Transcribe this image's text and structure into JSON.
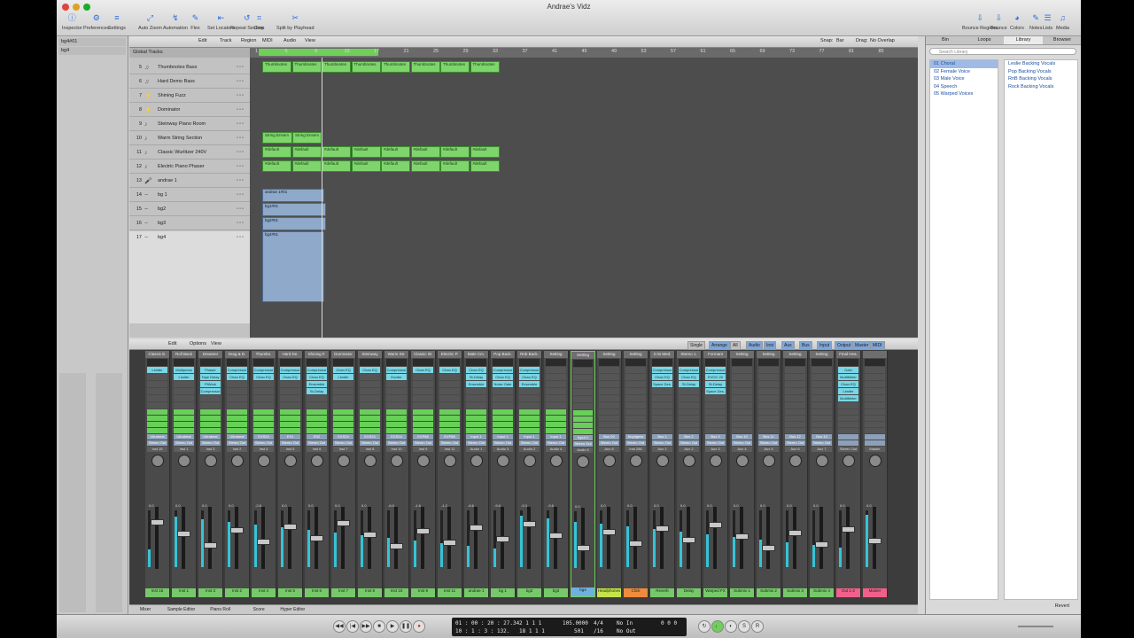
{
  "window": {
    "title": "Andrae's Vidz"
  },
  "toolbar": {
    "left": [
      "Inspector",
      "Preferences",
      "Settings"
    ],
    "center": [
      "Auto Zoom",
      "Automation",
      "Flex",
      "Set Locators",
      "Repeat Section",
      "Crop",
      "Split by Playhead"
    ],
    "right": [
      "Bounce Regions",
      "Bounce",
      "Colors",
      "Notes",
      "Lists",
      "Media"
    ]
  },
  "inspector": {
    "items": [
      "bg4#01",
      "bg4"
    ]
  },
  "tracks_bar": {
    "menus": [
      "Edit",
      "Track",
      "Region",
      "MIDI",
      "Audio",
      "View"
    ],
    "snap_label": "Snap:",
    "snap_value": "Bar",
    "drag_label": "Drag:",
    "drag_value": "No Overlap"
  },
  "global_tracks": "Global Tracks",
  "ruler": [
    "1",
    "5",
    "9",
    "13",
    "17",
    "21",
    "25",
    "29",
    "33",
    "37",
    "41",
    "45",
    "49",
    "53",
    "57",
    "61",
    "65",
    "69",
    "73",
    "77",
    "81",
    "85"
  ],
  "tracks": [
    {
      "num": "5",
      "name": "Thumbnotes Bass"
    },
    {
      "num": "6",
      "name": "Hard Demo Bass"
    },
    {
      "num": "7",
      "name": "Shining Fuzz"
    },
    {
      "num": "8",
      "name": "Dominator"
    },
    {
      "num": "9",
      "name": "Steinway Piano Room"
    },
    {
      "num": "10",
      "name": "Warm String Section"
    },
    {
      "num": "11",
      "name": "Classic Wurlitzer 240V"
    },
    {
      "num": "12",
      "name": "Electric Piano Phaser"
    },
    {
      "num": "13",
      "name": "andrae 1"
    },
    {
      "num": "14",
      "name": "bg 1"
    },
    {
      "num": "15",
      "name": "bg2"
    },
    {
      "num": "16",
      "name": "bg3"
    },
    {
      "num": "17",
      "name": "bg4"
    }
  ],
  "regions": {
    "thumb": "Thumbnotes",
    "string": "String Ensem",
    "default": "#default",
    "a1": "andrae 1#01",
    "a2": "bg1#01",
    "a3": "bg2#01",
    "a4": "bg4#01"
  },
  "library": {
    "tabs": [
      "Bin",
      "Loops",
      "Library",
      "Browser"
    ],
    "search_placeholder": "Search Library",
    "col1": [
      "01 Choral",
      "02 Female Voice",
      "03 Male Voice",
      "04 Speech",
      "05 Warped Voices"
    ],
    "col2": [
      "Leslie Backing Vocals",
      "Pop Backing Vocals",
      "RnB Backing Vocals",
      "Rock Backing Vocals"
    ],
    "revert": "Revert"
  },
  "mixer_bar": {
    "menus": [
      "Edit",
      "Options",
      "View"
    ],
    "modes": [
      "Single",
      "Arrange",
      "All"
    ],
    "filters": [
      "Audio",
      "Inst",
      "Aux",
      "Bus",
      "Input",
      "Output",
      "Master",
      "MIDI"
    ]
  },
  "channels": [
    {
      "hd": "Classic E.",
      "ins": [
        "Limiter"
      ],
      "io": "Ultrabeat",
      "out": "Stereo Out",
      "auto": "Inst 15",
      "db": "0.0",
      "name": "Inst 15"
    },
    {
      "hd": "Roll Back",
      "ins": [
        "Multipress",
        "Limiter"
      ],
      "io": "Ultrabeat",
      "out": "Stereo Out",
      "auto": "Inst 1",
      "db": "0.0",
      "name": "Inst 1"
    },
    {
      "hd": "Dreamer",
      "ins": [
        "Phaser",
        "Tape Delay",
        "PtWork",
        "Compressor"
      ],
      "io": "Ultrabeat",
      "out": "Stereo Out",
      "auto": "Inst 3",
      "db": "0.0",
      "name": "Inst 3"
    },
    {
      "hd": "Drag & D.",
      "ins": [
        "Compressor",
        "Chan EQ"
      ],
      "io": "Ultrabeat",
      "out": "Stereo Out",
      "auto": "Inst 2",
      "db": "0.0",
      "name": "Inst 2"
    },
    {
      "hd": "Thumbn.",
      "ins": [
        "Compressor",
        "Chan EQ"
      ],
      "io": "EXS24",
      "out": "Stereo Out",
      "auto": "Inst 4",
      "db": "-2.8",
      "name": "Inst 4"
    },
    {
      "hd": "Hard De.",
      "ins": [
        "Compressor",
        "Chan EQ"
      ],
      "io": "ES1",
      "out": "Stereo Out",
      "auto": "Inst 5",
      "db": "0.0",
      "name": "Inst 5"
    },
    {
      "hd": "Shining F.",
      "ins": [
        "Compressor",
        "Chan EQ",
        "Ensemble",
        "St-Delay"
      ],
      "io": "ES2",
      "out": "Stereo Out",
      "auto": "Inst 6",
      "db": "0.0",
      "name": "Inst 6"
    },
    {
      "hd": "Dominator",
      "ins": [
        "Chan EQ",
        "Limiter"
      ],
      "io": "EXS24",
      "out": "Stereo Out",
      "auto": "Inst 7",
      "db": "0.0",
      "name": "Inst 7"
    },
    {
      "hd": "Steinway",
      "ins": [
        "Chan EQ"
      ],
      "io": "EXS24",
      "out": "Stereo Out",
      "auto": "Inst 8",
      "db": "0.0",
      "name": "Inst 8"
    },
    {
      "hd": "Warm Str.",
      "ins": [
        "Compressor",
        "Exciter"
      ],
      "io": "EXS24",
      "out": "Stereo Out",
      "auto": "Inst 10",
      "db": "-6.0",
      "name": "Inst 10"
    },
    {
      "hd": "Classic W.",
      "ins": [
        "Chan EQ"
      ],
      "io": "EVP88",
      "out": "Stereo Out",
      "auto": "Inst 9",
      "db": "-1.6",
      "name": "Inst 9"
    },
    {
      "hd": "Electric P.",
      "ins": [
        "Chan EQ"
      ],
      "io": "EVP88",
      "out": "Stereo Out",
      "auto": "Inst 11",
      "db": "-1.2",
      "name": "Inst 11"
    },
    {
      "hd": "Male Cm.",
      "ins": [
        "Chan EQ",
        "St-Delay",
        "Ensemble"
      ],
      "io": "Input 1",
      "out": "Stereo Out",
      "auto": "Audio 1",
      "db": "-8.6",
      "name": "andrae 1"
    },
    {
      "hd": "Pop Back.",
      "ins": [
        "Compressor",
        "Chan EQ",
        "Noise Gate"
      ],
      "io": "Input 1",
      "out": "Stereo Out",
      "auto": "Audio 3",
      "db": "-9.6",
      "name": "bg 1"
    },
    {
      "hd": "Rnb Back.",
      "ins": [
        "Compressor",
        "Chan EQ",
        "Ensemble"
      ],
      "io": "Input 1",
      "out": "Stereo Out",
      "auto": "Audio 2",
      "db": "-9.3",
      "name": "bg2"
    },
    {
      "hd": "Setting",
      "ins": [],
      "io": "Input 1",
      "out": "Stereo Out",
      "auto": "Audio 4",
      "db": "-9.6",
      "name": "bg3"
    },
    {
      "hd": "Setting",
      "ins": [],
      "io": "Input 1",
      "out": "Stereo Out",
      "auto": "Audio 5",
      "db": "0.0",
      "name": "bg4"
    },
    {
      "hd": "Setting",
      "ins": [],
      "io": "Bus 20",
      "out": "Stereo Out",
      "auto": "Aux 8",
      "db": "0.0",
      "name": "Headphones"
    },
    {
      "hd": "Setting",
      "ins": [],
      "io": "Klopfgeist",
      "out": "Stereo Out",
      "auto": "Inst 256",
      "db": "0.0",
      "name": "Click"
    },
    {
      "hd": "2.0s Med.",
      "ins": [
        "Compressor",
        "Chan EQ",
        "Space Des."
      ],
      "io": "Bus 1",
      "out": "Stereo Out",
      "auto": "Aux 1",
      "db": "0.0",
      "name": "Reverb"
    },
    {
      "hd": "Stereo 1.",
      "ins": [
        "Compressor",
        "Chan EQ",
        "St-Delay"
      ],
      "io": "Bus 2",
      "out": "Stereo Out",
      "auto": "Aux 2",
      "db": "0.0",
      "name": "Delay"
    },
    {
      "hd": "Formant",
      "ins": [
        "Compressor",
        "EVOC 20",
        "St-Delay",
        "Space Des."
      ],
      "io": "Bus 3",
      "out": "Stereo Out",
      "auto": "Aux 3",
      "db": "0.0",
      "name": "Warped FX"
    },
    {
      "hd": "Setting",
      "ins": [],
      "io": "Bus 10",
      "out": "Stereo Out",
      "auto": "Aux 4",
      "db": "0.0",
      "name": "Submix 1"
    },
    {
      "hd": "Setting",
      "ins": [],
      "io": "Bus 11",
      "out": "Stereo Out",
      "auto": "Aux 5",
      "db": "0.0",
      "name": "Submix 2"
    },
    {
      "hd": "Setting",
      "ins": [],
      "io": "Bus 12",
      "out": "Stereo Out",
      "auto": "Aux 6",
      "db": "0.0",
      "name": "Submix 3"
    },
    {
      "hd": "Setting",
      "ins": [],
      "io": "Bus 13",
      "out": "Stereo Out",
      "auto": "Aux 7",
      "db": "0.0",
      "name": "Submix 4"
    },
    {
      "hd": "Final Hea.",
      "ins": [
        "Gain",
        "MultiMeter",
        "Chan EQ",
        "Limiter",
        "MultiMeter"
      ],
      "io": "",
      "out": "",
      "auto": "Stereo Out",
      "db": "0.0",
      "name": "Out 1-2"
    },
    {
      "hd": "",
      "ins": [],
      "io": "",
      "out": "",
      "auto": "Master",
      "db": "0.0",
      "name": "Master"
    }
  ],
  "mixer_tabs": [
    "Mixer",
    "Sample Editor",
    "Piano Roll",
    "Score",
    "Hyper Editor"
  ],
  "transport": {
    "time": "01 : 00 : 20 : 27.34",
    "frames": "10 : 1 : 3 : 132.",
    "bars": "2  1  1  1",
    "bars2": "18  1  1  1",
    "tempo": "105.0000",
    "tempo2": "501",
    "sig": "4/4",
    "sig2": "/16",
    "in": "No In",
    "out": "No Out",
    "cpu": "0 0 0"
  },
  "colors": {
    "region_green": "#7ed56c",
    "insert_cyan": "#79d6e6",
    "audio_blue": "#8ea9c9"
  }
}
